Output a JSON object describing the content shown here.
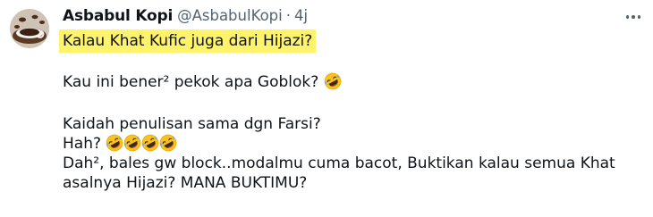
{
  "author": {
    "display_name": "Asbabul Kopi",
    "handle": "@AsbabulKopi",
    "separator": "·",
    "time": "4j"
  },
  "tweet": {
    "highlighted_line": "Kalau Khat Kufic juga dari Hijazi?",
    "paragraph2": "Kau ini bener² pekok apa Goblok?",
    "paragraph3_line1": "Kaidah penulisan sama dgn Farsi?",
    "paragraph3_line2": "Hah?",
    "paragraph3_line3": "Dah², bales gw block..modalmu cuma bacot, Buktikan kalau semua Khat",
    "paragraph3_line4": "asalnya Hijazi? MANA BUKTIMU?"
  },
  "icons": {
    "emoji": "rolling-on-floor-laughing-emoji",
    "more": "more-options-icon"
  },
  "colors": {
    "highlight": "#fff36b",
    "text": "#0f1419",
    "secondary": "#536471"
  }
}
